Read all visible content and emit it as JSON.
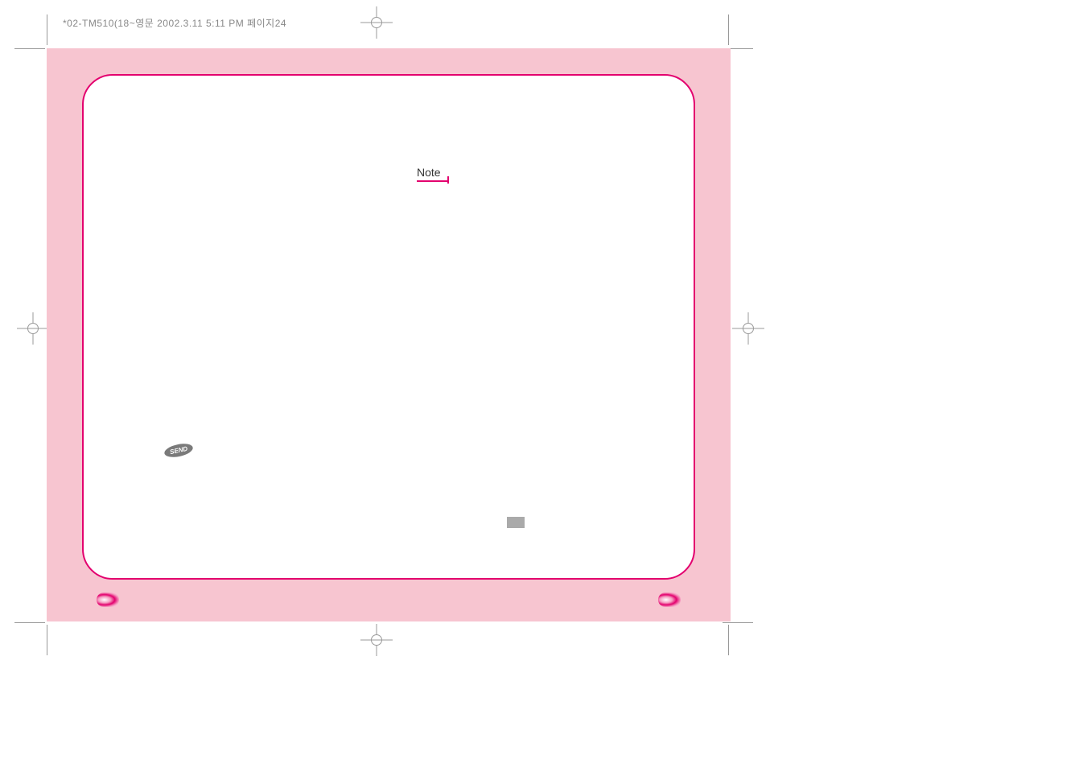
{
  "header": {
    "text": "*02-TM510(18~영문  2002.3.11 5:11 PM  페이지24"
  },
  "content": {
    "note_label": "Note",
    "send_label": "SEND"
  }
}
